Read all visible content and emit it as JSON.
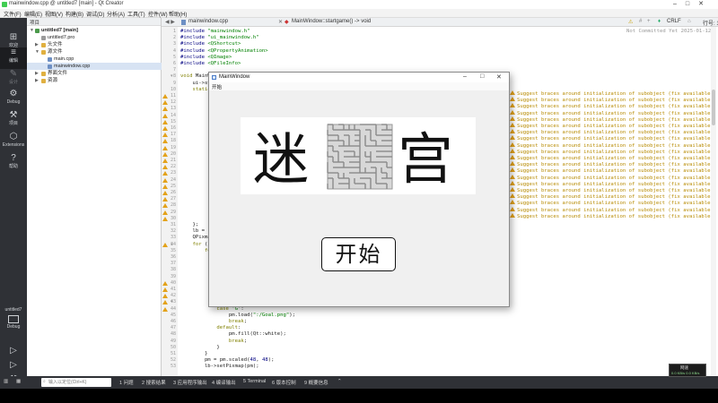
{
  "window": {
    "title": "mainwindow.cpp @ untitled7 [main] - Qt Creator"
  },
  "menu": [
    "文件(F)",
    "编辑(E)",
    "视图(V)",
    "构建(B)",
    "调试(D)",
    "分析(A)",
    "工具(T)",
    "控件(W)",
    "帮助(H)"
  ],
  "modes": [
    {
      "label": "欢迎",
      "icon": "⊞"
    },
    {
      "label": "编辑",
      "icon": "≡"
    },
    {
      "label": "设计",
      "icon": "✎"
    },
    {
      "label": "Debug",
      "icon": "⚙"
    },
    {
      "label": "项目",
      "icon": "⚒"
    },
    {
      "label": "Extensions",
      "icon": "⬡"
    },
    {
      "label": "帮助",
      "icon": "?"
    }
  ],
  "kit": {
    "project": "untitled7",
    "mode": "Debug"
  },
  "project_panel": {
    "header": "项目",
    "tree": [
      {
        "label": "untitled7 [main]"
      },
      {
        "label": "untitled7.pro"
      },
      {
        "label": "头文件"
      },
      {
        "label": "源文件"
      },
      {
        "label": "main.cpp"
      },
      {
        "label": "mainwindow.cpp"
      },
      {
        "label": "界面文件"
      },
      {
        "label": "资源"
      }
    ]
  },
  "editor": {
    "file_tab": "mainwindow.cpp",
    "symbol": "MainWindow::startgame() -> void",
    "line_ending": "CRLF",
    "position": "行号: 1, 列号: 1",
    "commit_info": "Not Committed Yet 2025-01-12",
    "line_numbers": [
      "1",
      "2",
      "3",
      "4",
      "5",
      "6",
      "7",
      "8",
      "9",
      "10",
      "11",
      "12",
      "13",
      "14",
      "15",
      "16",
      "17",
      "18",
      "19",
      "20",
      "21",
      "22",
      "23",
      "24",
      "25",
      "26",
      "27",
      "28",
      "29",
      "30",
      "31",
      "32",
      "33",
      "34",
      "35",
      "36",
      "37",
      "38",
      "39",
      "40",
      "41",
      "42",
      "43",
      "44",
      "45",
      "46",
      "47",
      "48",
      "49",
      "50",
      "51",
      "52",
      "53"
    ],
    "top_code": [
      [
        {
          "c": "pp",
          "t": "#include "
        },
        {
          "c": "str",
          "t": "\"mainwindow.h\""
        }
      ],
      [
        {
          "c": "pp",
          "t": "#include "
        },
        {
          "c": "str",
          "t": "\"ui_mainwindow.h\""
        }
      ],
      [
        {
          "c": "pp",
          "t": "#include "
        },
        {
          "c": "str",
          "t": "<QShortcut>"
        }
      ],
      [
        {
          "c": "pp",
          "t": "#include "
        },
        {
          "c": "str",
          "t": "<QPropertyAnimation>"
        }
      ],
      [
        {
          "c": "pp",
          "t": "#include "
        },
        {
          "c": "str",
          "t": "<QImage>"
        }
      ],
      [
        {
          "c": "pp",
          "t": "#include "
        },
        {
          "c": "str",
          "t": "<QFileInfo>"
        }
      ],
      [
        {
          "c": "",
          "t": ""
        }
      ],
      [
        {
          "c": "kw",
          "t": "void "
        },
        {
          "c": "",
          "t": "MainW"
        }
      ],
      [
        {
          "c": "",
          "t": "    ui->st"
        }
      ],
      [
        {
          "c": "kw",
          "t": "    static"
        }
      ]
    ],
    "mid_code": [
      [
        {
          "c": "",
          "t": "    };"
        }
      ],
      [
        {
          "c": "",
          "t": "    lb = "
        }
      ],
      [
        {
          "c": "",
          "t": "    QPixma"
        }
      ],
      [
        {
          "c": "kw",
          "t": "    for "
        },
        {
          "c": "",
          "t": "(i"
        }
      ],
      [
        {
          "c": "kw",
          "t": "        fo"
        }
      ]
    ],
    "bottom_code": [
      [
        {
          "c": "kw",
          "t": "                break"
        },
        {
          "c": "",
          "t": ";"
        }
      ],
      [
        {
          "c": "kw",
          "t": "            case "
        },
        {
          "c": "str",
          "t": "'G'"
        },
        {
          "c": "",
          "t": ":"
        }
      ],
      [
        {
          "c": "",
          "t": "                pm.load("
        },
        {
          "c": "str",
          "t": "\":/Goal.png\""
        },
        {
          "c": "",
          "t": ");"
        }
      ],
      [
        {
          "c": "kw",
          "t": "                break"
        },
        {
          "c": "",
          "t": ";"
        }
      ],
      [
        {
          "c": "kw",
          "t": "            default"
        },
        {
          "c": "",
          "t": ":"
        }
      ],
      [
        {
          "c": "",
          "t": "                pm.fill(Qt::white);"
        }
      ],
      [
        {
          "c": "kw",
          "t": "                break"
        },
        {
          "c": "",
          "t": ";"
        }
      ],
      [
        {
          "c": "",
          "t": "            }"
        }
      ],
      [
        {
          "c": "",
          "t": "        }"
        }
      ],
      [
        {
          "c": "",
          "t": "        pm = pm.scaled("
        },
        {
          "c": "num",
          "t": "48"
        },
        {
          "c": "",
          "t": ", "
        },
        {
          "c": "num",
          "t": "48"
        },
        {
          "c": "",
          "t": ");"
        }
      ],
      [
        {
          "c": "",
          "t": "        lb->setPixmap(pm);"
        }
      ]
    ],
    "warning_text": "Suggest braces around initialization of subobject (fix available)"
  },
  "status": {
    "locator_placeholder": "输入以定位(Ctrl+K)",
    "tabs": [
      "1 问题",
      "2 搜索结果",
      "3 应用程序输出",
      "4 编译输出",
      "5 Terminal",
      "6 版本控制",
      "9 概要信息"
    ]
  },
  "net_widget": {
    "title": "网速",
    "value": "0.0 KB/s 0.0 KB/s"
  },
  "app_window": {
    "title": "MainWindow",
    "menu": "开始",
    "banner_left": "迷",
    "banner_right": "宫",
    "start_label": "开始"
  }
}
